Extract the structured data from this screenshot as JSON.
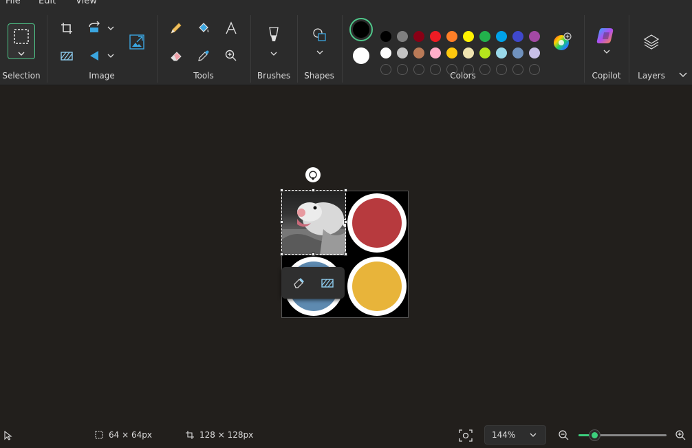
{
  "menu": {
    "file": "File",
    "edit": "Edit",
    "view": "View"
  },
  "ribbon": {
    "groups": {
      "selection": "Selection",
      "image": "Image",
      "tools": "Tools",
      "brushes": "Brushes",
      "shapes": "Shapes",
      "colors": "Colors",
      "copilot": "Copilot",
      "layers": "Layers"
    },
    "primary_color": "#000000",
    "secondary_color": "#ffffff",
    "accent_color": "#4fc78a",
    "palette_row1": [
      "#000000",
      "#7f7f7f",
      "#880015",
      "#ed1c24",
      "#ff7f27",
      "#fff200",
      "#22b14c",
      "#00a2e8",
      "#3f48cc",
      "#a349a4"
    ],
    "palette_row2": [
      "#ffffff",
      "#c3c3c3",
      "#b97a57",
      "#ffaec9",
      "#ffc90e",
      "#efe4b0",
      "#b5e61d",
      "#99d9ea",
      "#7092be",
      "#c8bfe7"
    ],
    "palette_row3_empty_count": 10
  },
  "canvas_image": {
    "circle_colors": [
      "#b73a3e",
      "#e8b43a",
      "#5e8ab0"
    ],
    "ring_color": "#ffffff",
    "background": "#000000"
  },
  "status": {
    "selection_size": "64 × 64px",
    "canvas_size": "128 × 128px",
    "zoom": "144%",
    "zoom_fraction": 0.18
  }
}
